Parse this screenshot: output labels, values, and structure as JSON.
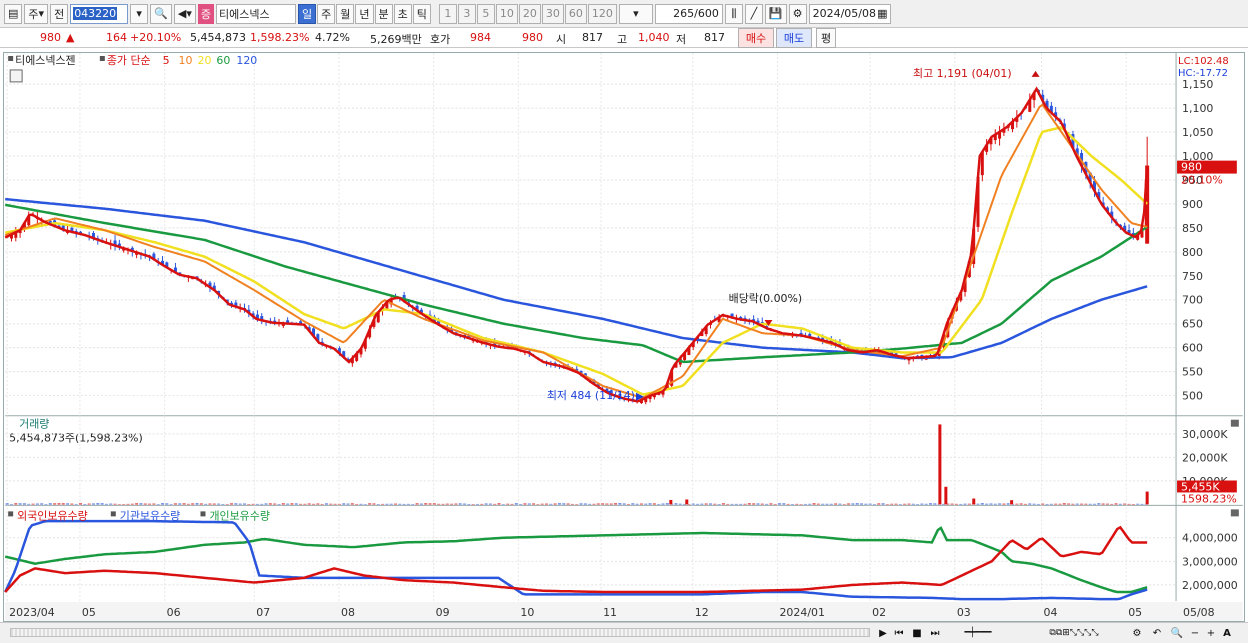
{
  "toolbar": {
    "market": "주",
    "period_type": "전",
    "stock_code": "043220",
    "badge": "증",
    "stock_name": "티에스넥스",
    "periods": [
      {
        "label": "일",
        "active": true
      },
      {
        "label": "주",
        "active": false
      },
      {
        "label": "월",
        "active": false
      },
      {
        "label": "년",
        "active": false
      },
      {
        "label": "분",
        "active": false
      },
      {
        "label": "초",
        "active": false
      },
      {
        "label": "틱",
        "active": false
      }
    ],
    "intervals": [
      "1",
      "3",
      "5",
      "10",
      "20",
      "30",
      "60",
      "120"
    ],
    "bar_count": "265",
    "bar_total": "/600",
    "date": "2024/05/08"
  },
  "price_row": {
    "price": "980",
    "arrow": "▲",
    "change": "164",
    "change_pct": "+20.10%",
    "volume": "5,454,873",
    "volume_pct": "1,598.23%",
    "turnover": "4.72%",
    "amount": "5,269백만",
    "quote_label": "호가",
    "ask": "984",
    "bid": "980",
    "open_label": "시",
    "open": "817",
    "high_label": "고",
    "high": "1,040",
    "low_label": "저",
    "low": "817",
    "buy": "매수",
    "sell": "매도",
    "eval": "평"
  },
  "chart_data": [
    {
      "type": "candlestick",
      "title": "티에스넥스젠",
      "legend": {
        "label": "종가 단순",
        "ma": [
          "5",
          "10",
          "20",
          "60",
          "120"
        ],
        "colors": [
          "#d81010",
          "#f08020",
          "#f0e020",
          "#1a9a40",
          "#2a55dd"
        ]
      },
      "x_ticks": [
        "2023/04",
        "05",
        "06",
        "07",
        "08",
        "09",
        "10",
        "11",
        "12",
        "2024/01",
        "02",
        "03",
        "04",
        "05",
        "05/08"
      ],
      "y_ticks": [
        500,
        550,
        600,
        650,
        700,
        750,
        800,
        850,
        900,
        950,
        1000,
        1050,
        1100,
        1150
      ],
      "ylim": [
        460,
        1190
      ],
      "last_price_label": "980",
      "last_change_label": "20.10%",
      "max_label": "최고 1,191 (04/01)",
      "min_label": "최저 484 (11/14)",
      "event_label": "배당락(0.00%)",
      "lc_label": "LC:102.48",
      "hc_label": "HC:-17.72",
      "close_keypoints": [
        [
          0,
          830
        ],
        [
          15,
          845
        ],
        [
          25,
          880
        ],
        [
          40,
          862
        ],
        [
          60,
          845
        ],
        [
          80,
          835
        ],
        [
          100,
          820
        ],
        [
          115,
          810
        ],
        [
          130,
          800
        ],
        [
          145,
          790
        ],
        [
          160,
          770
        ],
        [
          175,
          752
        ],
        [
          192,
          745
        ],
        [
          210,
          720
        ],
        [
          225,
          690
        ],
        [
          240,
          680
        ],
        [
          252,
          660
        ],
        [
          268,
          652
        ],
        [
          285,
          650
        ],
        [
          300,
          648
        ],
        [
          315,
          610
        ],
        [
          330,
          598
        ],
        [
          345,
          570
        ],
        [
          358,
          600
        ],
        [
          372,
          668
        ],
        [
          385,
          700
        ],
        [
          395,
          705
        ],
        [
          405,
          690
        ],
        [
          420,
          668
        ],
        [
          435,
          648
        ],
        [
          450,
          630
        ],
        [
          465,
          620
        ],
        [
          480,
          610
        ],
        [
          495,
          602
        ],
        [
          510,
          598
        ],
        [
          525,
          590
        ],
        [
          540,
          570
        ],
        [
          560,
          560
        ],
        [
          575,
          548
        ],
        [
          590,
          525
        ],
        [
          605,
          505
        ],
        [
          620,
          494
        ],
        [
          635,
          488
        ],
        [
          648,
          500
        ],
        [
          662,
          510
        ],
        [
          670,
          560
        ],
        [
          690,
          610
        ],
        [
          705,
          648
        ],
        [
          720,
          668
        ],
        [
          735,
          660
        ],
        [
          750,
          655
        ],
        [
          765,
          640
        ],
        [
          780,
          630
        ],
        [
          800,
          625
        ],
        [
          815,
          618
        ],
        [
          830,
          610
        ],
        [
          845,
          595
        ],
        [
          860,
          590
        ],
        [
          875,
          595
        ],
        [
          890,
          585
        ],
        [
          905,
          578
        ],
        [
          920,
          580
        ],
        [
          935,
          583
        ],
        [
          945,
          650
        ],
        [
          960,
          720
        ],
        [
          970,
          800
        ],
        [
          978,
          1000
        ],
        [
          990,
          1040
        ],
        [
          1005,
          1060
        ],
        [
          1020,
          1090
        ],
        [
          1035,
          1140
        ],
        [
          1045,
          1100
        ],
        [
          1060,
          1070
        ],
        [
          1075,
          1000
        ],
        [
          1090,
          940
        ],
        [
          1100,
          900
        ],
        [
          1115,
          860
        ],
        [
          1125,
          840
        ],
        [
          1135,
          830
        ],
        [
          1142,
          850
        ],
        [
          1146,
          980
        ]
      ],
      "ma120_keypoints": [
        [
          0,
          910
        ],
        [
          100,
          890
        ],
        [
          200,
          865
        ],
        [
          300,
          820
        ],
        [
          400,
          760
        ],
        [
          500,
          700
        ],
        [
          600,
          660
        ],
        [
          680,
          620
        ],
        [
          760,
          600
        ],
        [
          850,
          590
        ],
        [
          900,
          578
        ],
        [
          950,
          580
        ],
        [
          1000,
          610
        ],
        [
          1050,
          660
        ],
        [
          1100,
          700
        ],
        [
          1146,
          728
        ]
      ],
      "ma60_keypoints": [
        [
          0,
          898
        ],
        [
          100,
          860
        ],
        [
          200,
          825
        ],
        [
          280,
          770
        ],
        [
          350,
          730
        ],
        [
          420,
          690
        ],
        [
          500,
          650
        ],
        [
          580,
          620
        ],
        [
          640,
          605
        ],
        [
          680,
          570
        ],
        [
          760,
          580
        ],
        [
          850,
          590
        ],
        [
          900,
          598
        ],
        [
          960,
          610
        ],
        [
          1000,
          650
        ],
        [
          1050,
          740
        ],
        [
          1100,
          790
        ],
        [
          1146,
          852
        ]
      ],
      "ma20_keypoints": [
        [
          0,
          840
        ],
        [
          50,
          860
        ],
        [
          100,
          845
        ],
        [
          150,
          820
        ],
        [
          200,
          790
        ],
        [
          250,
          738
        ],
        [
          300,
          670
        ],
        [
          340,
          640
        ],
        [
          380,
          680
        ],
        [
          420,
          670
        ],
        [
          480,
          620
        ],
        [
          540,
          590
        ],
        [
          600,
          545
        ],
        [
          640,
          502
        ],
        [
          680,
          520
        ],
        [
          720,
          610
        ],
        [
          760,
          650
        ],
        [
          800,
          640
        ],
        [
          850,
          600
        ],
        [
          900,
          590
        ],
        [
          940,
          590
        ],
        [
          980,
          700
        ],
        [
          1010,
          880
        ],
        [
          1040,
          1050
        ],
        [
          1060,
          1060
        ],
        [
          1090,
          1000
        ],
        [
          1120,
          950
        ],
        [
          1146,
          900
        ]
      ],
      "ma10_keypoints": [
        [
          0,
          835
        ],
        [
          50,
          870
        ],
        [
          100,
          845
        ],
        [
          150,
          810
        ],
        [
          200,
          780
        ],
        [
          250,
          720
        ],
        [
          300,
          655
        ],
        [
          340,
          610
        ],
        [
          380,
          700
        ],
        [
          420,
          660
        ],
        [
          480,
          615
        ],
        [
          540,
          590
        ],
        [
          600,
          520
        ],
        [
          640,
          495
        ],
        [
          680,
          540
        ],
        [
          720,
          660
        ],
        [
          760,
          630
        ],
        [
          800,
          625
        ],
        [
          850,
          595
        ],
        [
          900,
          582
        ],
        [
          940,
          600
        ],
        [
          970,
          780
        ],
        [
          1000,
          960
        ],
        [
          1040,
          1110
        ],
        [
          1070,
          1020
        ],
        [
          1100,
          930
        ],
        [
          1130,
          860
        ],
        [
          1146,
          852
        ]
      ]
    },
    {
      "type": "bar",
      "title": "거래량",
      "legend_text": "5,454,873주(1,598.23%)",
      "y_ticks": [
        "30,000K",
        "20,000K",
        "10,000K"
      ],
      "last_label": "5,455K",
      "last_pct_label": "1598.23%",
      "spikes": [
        [
          668,
          1900
        ],
        [
          684,
          2100
        ],
        [
          938,
          34000
        ],
        [
          944,
          7500
        ],
        [
          972,
          2500
        ],
        [
          1010,
          1800
        ],
        [
          1146,
          5455
        ]
      ],
      "baseline": 300,
      "ylim": [
        0,
        36000
      ]
    },
    {
      "type": "line",
      "series": [
        {
          "name": "외국인보유수량",
          "color": "#d81010"
        },
        {
          "name": "기관보유수량",
          "color": "#2a55dd"
        },
        {
          "name": "개인보유수량",
          "color": "#1a9a40"
        }
      ],
      "y_ticks": [
        "4,000,000",
        "3,000,000",
        "2,000,000"
      ],
      "ylim": [
        1400000,
        5200000
      ],
      "red_keypoints": [
        [
          0,
          1700000
        ],
        [
          15,
          2400000
        ],
        [
          30,
          2700000
        ],
        [
          60,
          2500000
        ],
        [
          100,
          2600000
        ],
        [
          150,
          2500000
        ],
        [
          200,
          2300000
        ],
        [
          250,
          2100000
        ],
        [
          300,
          2300000
        ],
        [
          330,
          2700000
        ],
        [
          360,
          2400000
        ],
        [
          400,
          2200000
        ],
        [
          450,
          2100000
        ],
        [
          500,
          1900000
        ],
        [
          540,
          1750000
        ],
        [
          600,
          1700000
        ],
        [
          700,
          1700000
        ],
        [
          800,
          1800000
        ],
        [
          850,
          2000000
        ],
        [
          900,
          2100000
        ],
        [
          940,
          2000000
        ],
        [
          960,
          2400000
        ],
        [
          990,
          3000000
        ],
        [
          1010,
          3900000
        ],
        [
          1025,
          3500000
        ],
        [
          1040,
          4000000
        ],
        [
          1060,
          3200000
        ],
        [
          1080,
          3400000
        ],
        [
          1100,
          3300000
        ],
        [
          1118,
          4500000
        ],
        [
          1130,
          3800000
        ],
        [
          1146,
          3800000
        ]
      ],
      "blue_keypoints": [
        [
          0,
          1700000
        ],
        [
          10,
          2600000
        ],
        [
          25,
          4500000
        ],
        [
          40,
          4700000
        ],
        [
          100,
          4700000
        ],
        [
          150,
          4700000
        ],
        [
          230,
          4650000
        ],
        [
          245,
          3800000
        ],
        [
          255,
          2400000
        ],
        [
          300,
          2300000
        ],
        [
          400,
          2300000
        ],
        [
          495,
          2300000
        ],
        [
          520,
          1600000
        ],
        [
          600,
          1600000
        ],
        [
          700,
          1600000
        ],
        [
          760,
          1700000
        ],
        [
          800,
          1700000
        ],
        [
          850,
          1500000
        ],
        [
          930,
          1450000
        ],
        [
          960,
          1400000
        ],
        [
          1000,
          1400000
        ],
        [
          1050,
          1450000
        ],
        [
          1100,
          1400000
        ],
        [
          1118,
          1400000
        ],
        [
          1130,
          1600000
        ],
        [
          1146,
          1800000
        ]
      ],
      "green_keypoints": [
        [
          0,
          3200000
        ],
        [
          30,
          2900000
        ],
        [
          60,
          3100000
        ],
        [
          100,
          3300000
        ],
        [
          150,
          3400000
        ],
        [
          200,
          3700000
        ],
        [
          240,
          3800000
        ],
        [
          260,
          3950000
        ],
        [
          300,
          3700000
        ],
        [
          350,
          3600000
        ],
        [
          400,
          3800000
        ],
        [
          450,
          3850000
        ],
        [
          500,
          4000000
        ],
        [
          600,
          4100000
        ],
        [
          700,
          4200000
        ],
        [
          800,
          4100000
        ],
        [
          850,
          3900000
        ],
        [
          900,
          3900000
        ],
        [
          930,
          3800000
        ],
        [
          938,
          4500000
        ],
        [
          945,
          3900000
        ],
        [
          970,
          3900000
        ],
        [
          1000,
          3400000
        ],
        [
          1010,
          3000000
        ],
        [
          1030,
          2900000
        ],
        [
          1050,
          2700000
        ],
        [
          1080,
          2200000
        ],
        [
          1100,
          1900000
        ],
        [
          1115,
          1700000
        ],
        [
          1130,
          1700000
        ],
        [
          1146,
          1900000
        ]
      ]
    }
  ],
  "colors": {
    "ma5": "#d81010",
    "ma10": "#f08020",
    "ma20": "#f0e020",
    "ma60": "#1a9a40",
    "ma120": "#2a55dd",
    "up": "#d81010",
    "down": "#2a55dd"
  },
  "bottom": {
    "icons": [
      "play-icon",
      "rewind-icon",
      "stop-icon",
      "forward-icon",
      "zoom-icon",
      "minus-icon",
      "plus-icon"
    ]
  }
}
